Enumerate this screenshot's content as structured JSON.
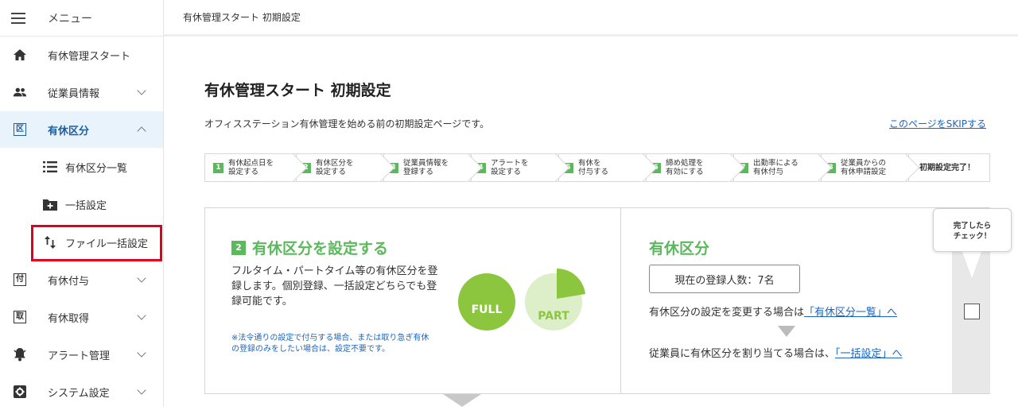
{
  "sidebar": {
    "menu_label": "メニュー",
    "items": [
      {
        "label": "有休管理スタート"
      },
      {
        "label": "従業員情報"
      },
      {
        "label": "有休区分"
      },
      {
        "label": "有休区分一覧"
      },
      {
        "label": "一括設定"
      },
      {
        "label": "ファイル一括設定"
      },
      {
        "label": "有休付与"
      },
      {
        "label": "有休取得"
      },
      {
        "label": "アラート管理"
      },
      {
        "label": "システム設定"
      }
    ],
    "icon_chars": {
      "fuyo": "付",
      "shutoku": "取",
      "kubun": "区"
    }
  },
  "topbar": {
    "breadcrumb": "有休管理スタート 初期設定"
  },
  "page": {
    "title": "有休管理スタート 初期設定",
    "description": "オフィスステーション有休管理を始める前の初期設定ページです。",
    "skip_link": "このページをSKIPする"
  },
  "steps": [
    {
      "num": "1",
      "text": "有休起点日を\n設定する"
    },
    {
      "num": "2",
      "text": "有休区分を\n設定する"
    },
    {
      "num": "3",
      "text": "従業員情報を\n登録する"
    },
    {
      "num": "4",
      "text": "アラートを\n設定する"
    },
    {
      "num": "5",
      "text": "有休を\n付与する"
    },
    {
      "num": "6",
      "text": "締め処理を\n有効にする"
    },
    {
      "num": "7",
      "text": "出勤率による\n有休付与"
    },
    {
      "num": "8",
      "text": "従業員からの\n有休申請設定"
    },
    {
      "num": "",
      "text": "初期設定完了！"
    }
  ],
  "card": {
    "step_num": "2",
    "title": "有休区分を設定する",
    "description": "フルタイム・パートタイム等の有休区分を登録します。個別登録、一括設定どちらでも登録可能です。",
    "note": "※法令通りの設定で付与する場合、または取り急ぎ有休の登録のみをしたい場合は、設定不要です。",
    "full_label": "FULL",
    "part_label": "PART",
    "right_title": "有休区分",
    "count_text": "現在の登録人数：7名",
    "change_text": "有休区分の設定を変更する場合は",
    "change_link": "「有休区分一覧」へ",
    "assign_text": "従業員に有休区分を割り当てる場合は、",
    "assign_link": "「一括設定」へ",
    "bubble_line1": "完了したら",
    "bubble_line2": "チェック！"
  },
  "colors": {
    "accent_green": "#5cb85c",
    "link_blue": "#1a66c0",
    "highlight_red": "#e0001b",
    "active_bg": "#e9f3fb"
  }
}
